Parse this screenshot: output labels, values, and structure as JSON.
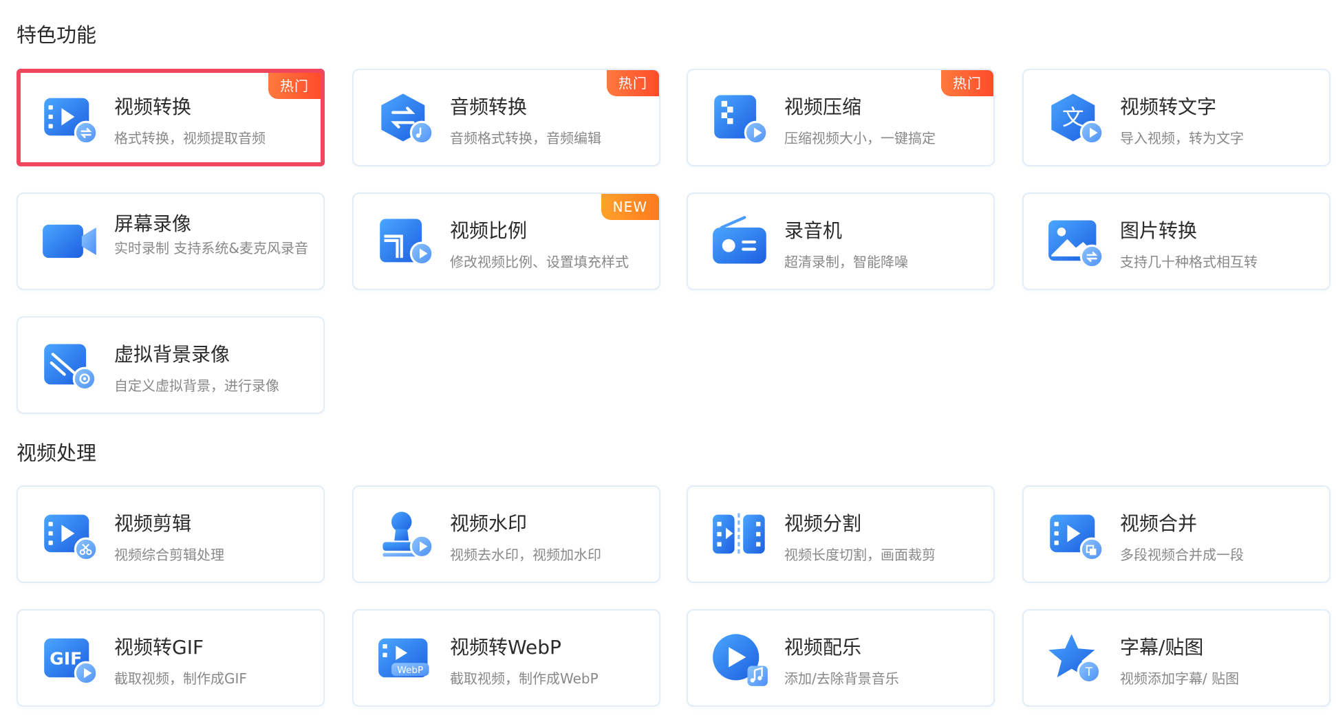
{
  "sections": [
    {
      "title": "特色功能"
    },
    {
      "title": "视频处理"
    }
  ],
  "colors": {
    "accent_blue": "#2f7ff0",
    "hot_badge": "#ff5a30",
    "new_badge": "#ff8a1e",
    "selected_border": "#f0475e"
  },
  "featured": [
    {
      "title": "视频转换",
      "desc": "格式转换，视频提取音频",
      "badge": "热门",
      "icon": "video-convert-icon",
      "selected": true
    },
    {
      "title": "音频转换",
      "desc": "音频格式转换，音频编辑",
      "badge": "热门",
      "icon": "audio-convert-icon"
    },
    {
      "title": "视频压缩",
      "desc": "压缩视频大小，一键搞定",
      "badge": "热门",
      "icon": "video-compress-icon"
    },
    {
      "title": "视频转文字",
      "desc": "导入视频，转为文字",
      "icon": "video-to-text-icon"
    },
    {
      "title": "屏幕录像",
      "desc": "实时录制 支持系统&麦克风录音",
      "icon": "screen-record-icon"
    },
    {
      "title": "视频比例",
      "desc": "修改视频比例、设置填充样式",
      "badge": "NEW",
      "icon": "video-ratio-icon"
    },
    {
      "title": "录音机",
      "desc": "超清录制，智能降噪",
      "icon": "recorder-icon"
    },
    {
      "title": "图片转换",
      "desc": "支持几十种格式相互转",
      "icon": "image-convert-icon"
    },
    {
      "title": "虚拟背景录像",
      "desc": "自定义虚拟背景，进行录像",
      "icon": "virtual-background-icon"
    }
  ],
  "video": [
    {
      "title": "视频剪辑",
      "desc": "视频综合剪辑处理",
      "icon": "video-edit-icon"
    },
    {
      "title": "视频水印",
      "desc": "视频去水印，视频加水印",
      "icon": "video-watermark-icon"
    },
    {
      "title": "视频分割",
      "desc": "视频长度切割，画面裁剪",
      "icon": "video-split-icon"
    },
    {
      "title": "视频合并",
      "desc": "多段视频合并成一段",
      "icon": "video-merge-icon"
    },
    {
      "title": "视频转GIF",
      "desc": "截取视频，制作成GIF",
      "icon": "video-to-gif-icon",
      "icon_text": "GIF"
    },
    {
      "title": "视频转WebP",
      "desc": "截取视频，制作成WebP",
      "icon": "video-to-webp-icon",
      "icon_text": "WebP"
    },
    {
      "title": "视频配乐",
      "desc": "添加/去除背景音乐",
      "icon": "video-music-icon"
    },
    {
      "title": "字幕/贴图",
      "desc": "视频添加字幕/ 贴图",
      "icon": "subtitle-sticker-icon"
    }
  ]
}
